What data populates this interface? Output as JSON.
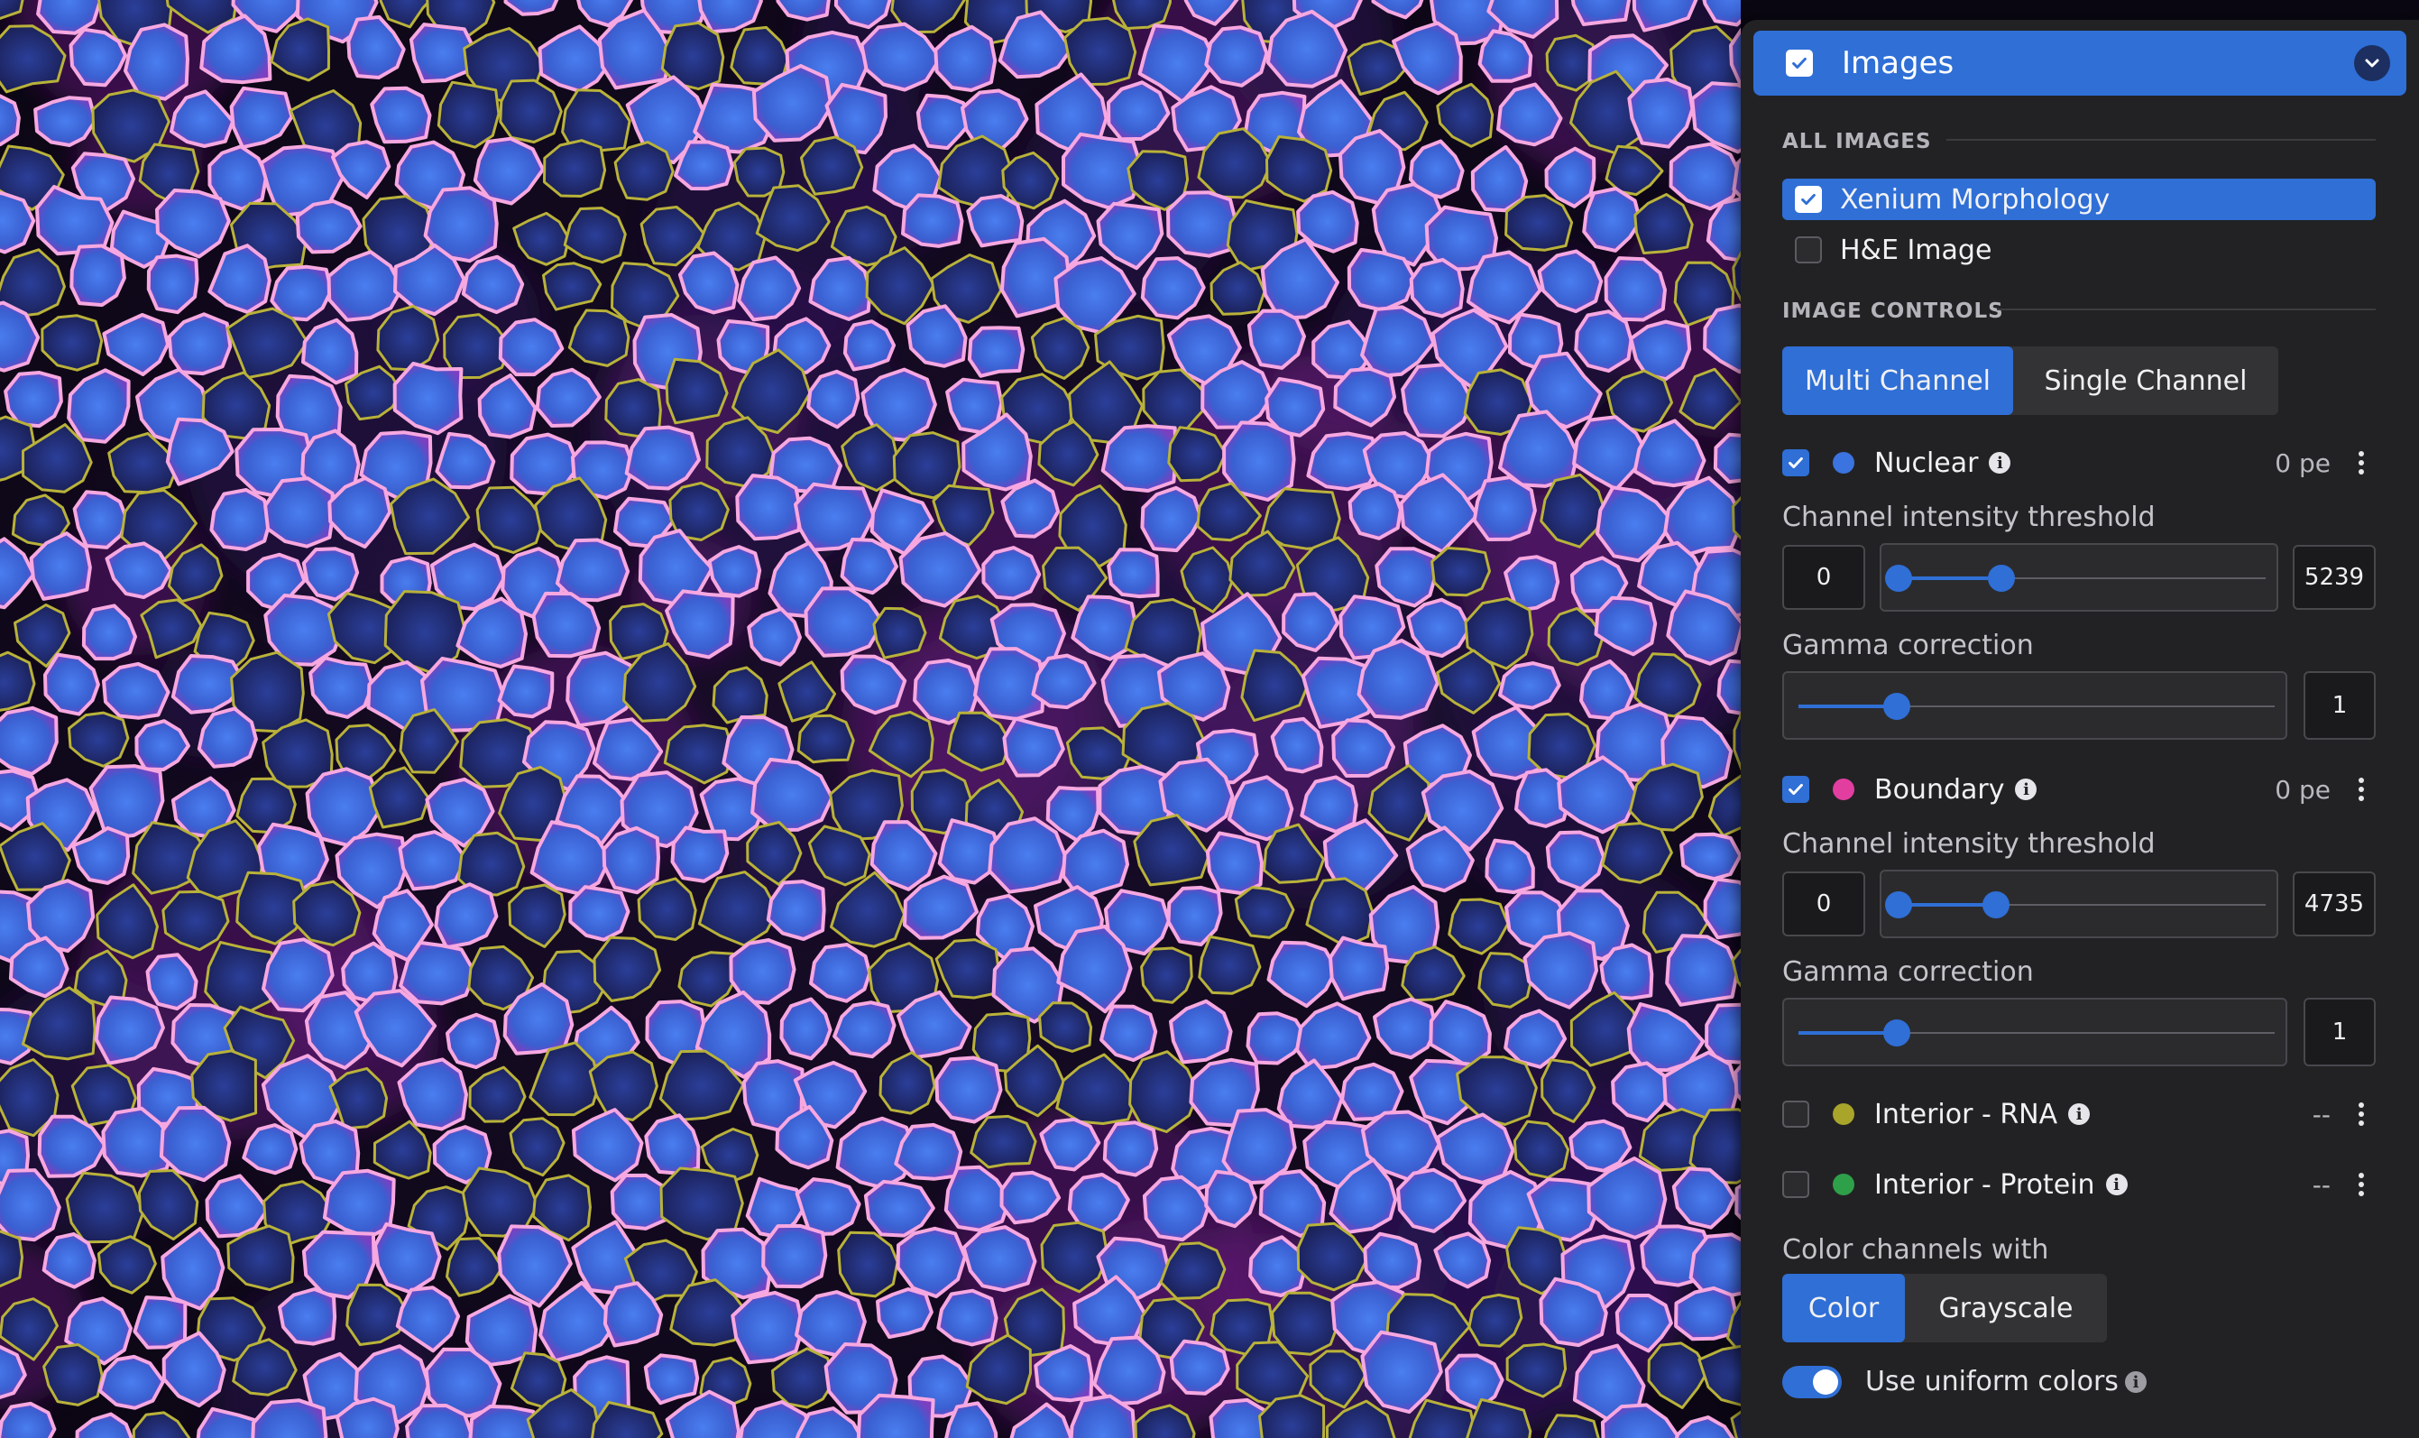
{
  "colors": {
    "accent": "#2f6fd6",
    "nuclear": "#3b73e0",
    "boundary": "#e23ea0",
    "interior_rna": "#a8a52a",
    "interior_protein": "#2ea04a"
  },
  "panel": {
    "title": "Images",
    "title_checked": true,
    "all_images_label": "ALL IMAGES",
    "images": [
      {
        "label": "Xenium Morphology",
        "checked": true,
        "selected": true
      },
      {
        "label": "H&E Image",
        "checked": false,
        "selected": false
      }
    ],
    "image_controls_label": "IMAGE CONTROLS",
    "mode_tabs": [
      {
        "label": "Multi Channel",
        "active": true
      },
      {
        "label": "Single Channel",
        "active": false
      }
    ],
    "channels": [
      {
        "name": "Nuclear",
        "checked": true,
        "value": "0 pe",
        "icon": "info-icon",
        "threshold_label": "Channel intensity threshold",
        "threshold_min": "0",
        "threshold_max": "5239",
        "gamma_label": "Gamma correction",
        "gamma_value": "1"
      },
      {
        "name": "Boundary",
        "checked": true,
        "value": "0 pe",
        "icon": "info-icon",
        "threshold_label": "Channel intensity threshold",
        "threshold_min": "0",
        "threshold_max": "4735",
        "gamma_label": "Gamma correction",
        "gamma_value": "1"
      },
      {
        "name": "Interior - RNA",
        "checked": false,
        "value": "--",
        "icon": "info-icon"
      },
      {
        "name": "Interior - Protein",
        "checked": false,
        "value": "--",
        "icon": "info-icon"
      }
    ],
    "color_channels_label": "Color channels with",
    "color_tabs": [
      {
        "label": "Color",
        "active": true
      },
      {
        "label": "Grayscale",
        "active": false
      }
    ],
    "uniform_colors_label": "Use uniform colors",
    "uniform_colors_on": true
  }
}
